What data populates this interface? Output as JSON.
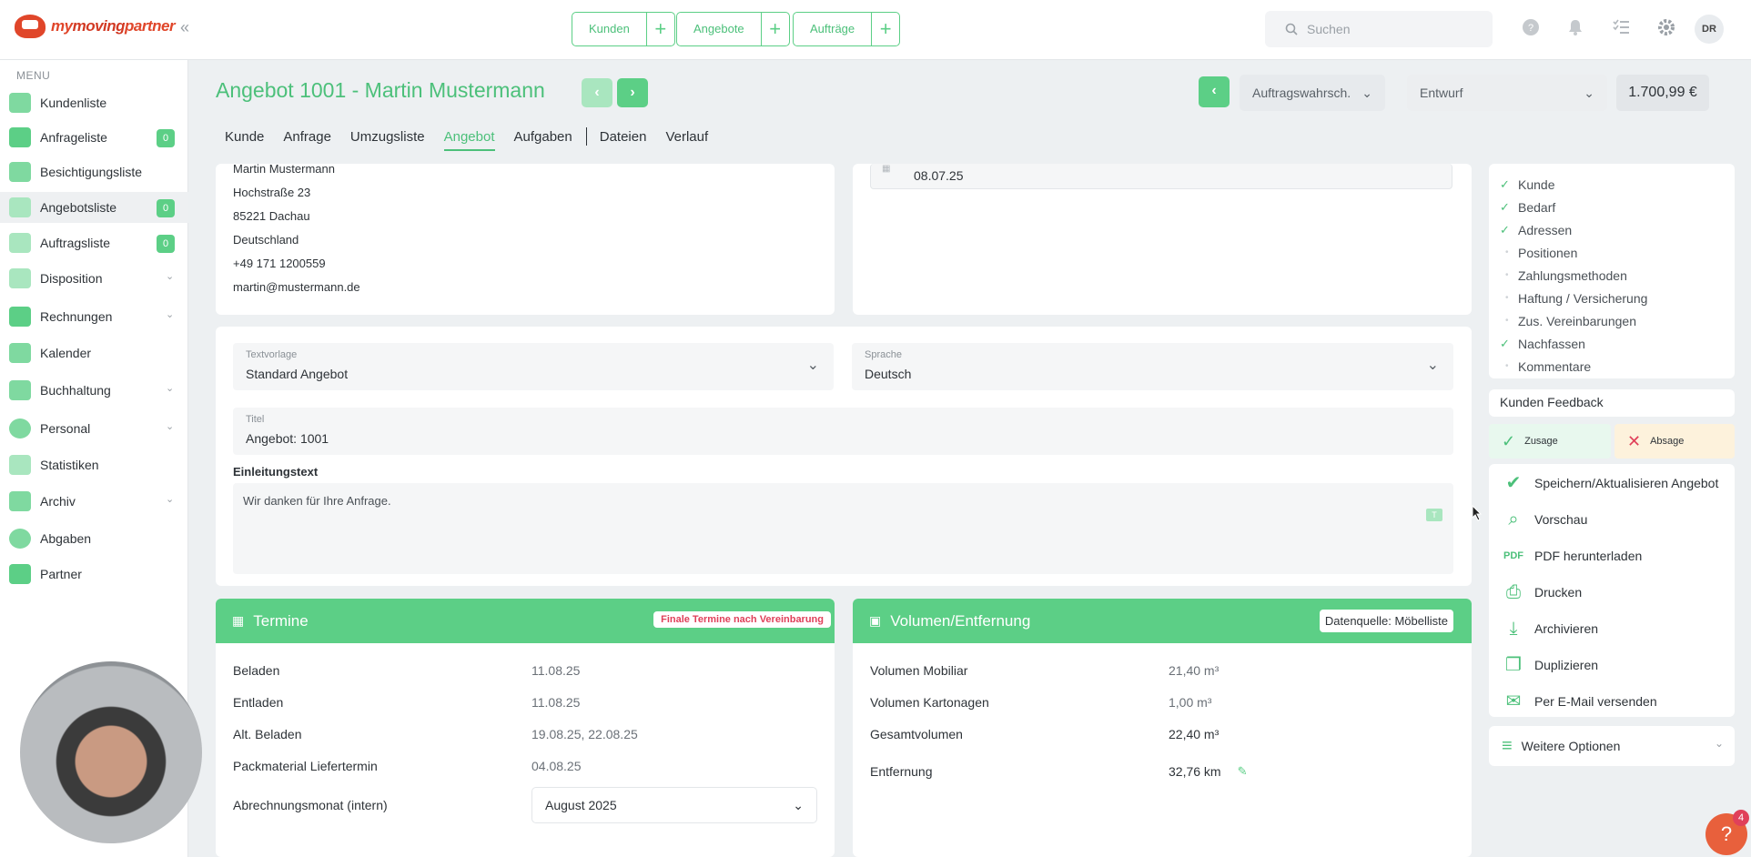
{
  "brand": {
    "name_part1": "my",
    "name_part2": "moving",
    "name_part3": "partner"
  },
  "topnav": {
    "groups": [
      {
        "label": "Kunden"
      },
      {
        "label": "Angebote"
      },
      {
        "label": "Aufträge"
      }
    ],
    "search_placeholder": "Suchen",
    "avatar": "DR"
  },
  "sidebar": {
    "heading": "MENU",
    "items": [
      {
        "label": "Kundenliste"
      },
      {
        "label": "Anfrageliste",
        "badge": "0"
      },
      {
        "label": "Besichtigungsliste"
      },
      {
        "label": "Angebotsliste",
        "badge": "0"
      },
      {
        "label": "Auftragsliste",
        "badge": "0"
      },
      {
        "label": "Disposition"
      },
      {
        "label": "Rechnungen"
      },
      {
        "label": "Kalender"
      },
      {
        "label": "Buchhaltung"
      },
      {
        "label": "Personal"
      },
      {
        "label": "Statistiken"
      },
      {
        "label": "Archiv"
      },
      {
        "label": "Abgaben"
      },
      {
        "label": "Partner"
      }
    ]
  },
  "header": {
    "title": "Angebot 1001 - Martin Mustermann",
    "probability_select": "Auftragswahrsch.",
    "status_select": "Entwurf",
    "total": "1.700,99 €",
    "tabs": [
      "Kunde",
      "Anfrage",
      "Umzugsliste",
      "Angebot",
      "Aufgaben",
      "Dateien",
      "Verlauf"
    ]
  },
  "customer": {
    "name": "Martin Mustermann",
    "street": "Hochstraße 23",
    "city": "85221 Dachau",
    "country": "Deutschland",
    "phone": "+49 171 1200559",
    "email": "martin@mustermann.de"
  },
  "date_field": {
    "value": "08.07.25"
  },
  "offer_form": {
    "template_label": "Textvorlage",
    "template_value": "Standard Angebot",
    "language_label": "Sprache",
    "language_value": "Deutsch",
    "title_label": "Titel",
    "title_value": "Angebot: 1001",
    "intro_label": "Einleitungstext",
    "intro_value": "Wir danken für Ihre Anfrage."
  },
  "termine": {
    "heading": "Termine",
    "badge": "Finale Termine nach Vereinbarung",
    "rows": [
      {
        "key": "Beladen",
        "value": "11.08.25"
      },
      {
        "key": "Entladen",
        "value": "11.08.25"
      },
      {
        "key": "Alt. Beladen",
        "value": "19.08.25, 22.08.25"
      },
      {
        "key": "Packmaterial Liefertermin",
        "value": "04.08.25"
      }
    ],
    "billing_label": "Abrechnungsmonat (intern)",
    "billing_value": "August 2025"
  },
  "volumen": {
    "heading": "Volumen/Entfernung",
    "source": "Datenquelle: Möbelliste",
    "rows": [
      {
        "key": "Volumen Mobiliar",
        "value": "21,40 m³"
      },
      {
        "key": "Volumen Kartonagen",
        "value": "1,00 m³"
      },
      {
        "key": "Gesamtvolumen",
        "value": "22,40 m³"
      },
      {
        "key": "Entfernung",
        "value": "32,76 km"
      }
    ]
  },
  "checklist": [
    {
      "label": "Kunde",
      "done": true
    },
    {
      "label": "Bedarf",
      "done": true
    },
    {
      "label": "Adressen",
      "done": true
    },
    {
      "label": "Positionen",
      "done": false
    },
    {
      "label": "Zahlungsmethoden",
      "done": false
    },
    {
      "label": "Haftung / Versicherung",
      "done": false
    },
    {
      "label": "Zus. Vereinbarungen",
      "done": false
    },
    {
      "label": "Nachfassen",
      "done": true
    },
    {
      "label": "Kommentare",
      "done": false
    }
  ],
  "feedback": {
    "heading": "Kunden Feedback",
    "accept": "Zusage",
    "reject": "Absage"
  },
  "actions": [
    {
      "label": "Speichern/Aktualisieren Angebot",
      "icon": "check-circle-icon"
    },
    {
      "label": "Vorschau",
      "icon": "magnifier-icon"
    },
    {
      "label": "PDF herunterladen",
      "icon": "pdf-icon"
    },
    {
      "label": "Drucken",
      "icon": "printer-icon"
    },
    {
      "label": "Archivieren",
      "icon": "download-icon"
    },
    {
      "label": "Duplizieren",
      "icon": "duplicate-icon"
    },
    {
      "label": "Per E-Mail versenden",
      "icon": "mail-icon"
    }
  ],
  "more_options": "Weitere Optionen",
  "help_badge": "4",
  "colors": {
    "accent": "#5ccf86",
    "accent_text": "#4cc07a",
    "danger": "#e0405a",
    "brand": "#e0462a"
  }
}
